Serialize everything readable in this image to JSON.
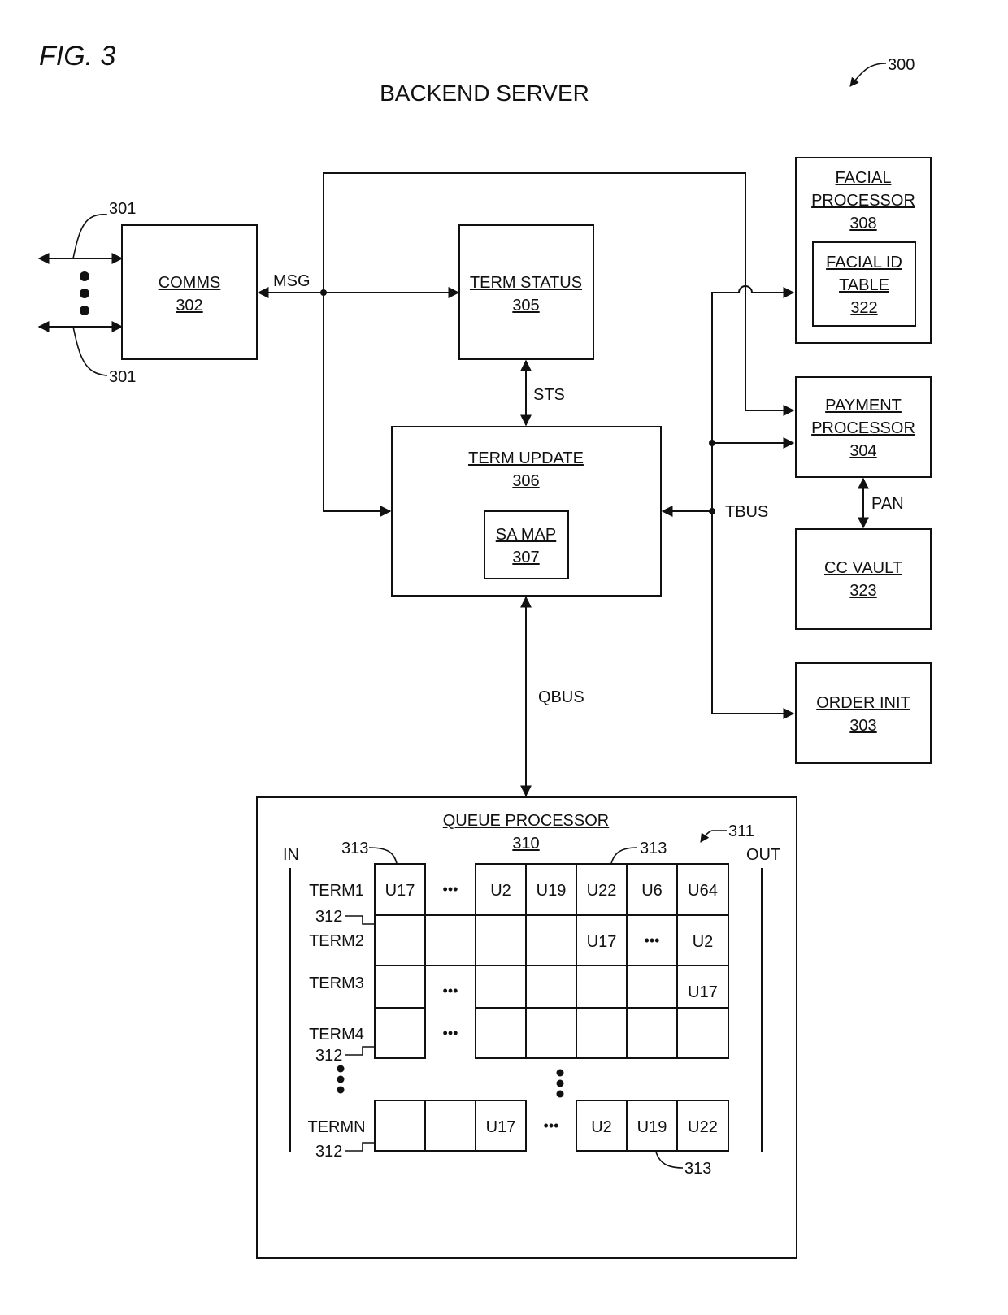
{
  "figure": {
    "label": "FIG. 3",
    "title": "BACKEND SERVER",
    "ref": "300"
  },
  "blocks": {
    "comms": {
      "name": "COMMS",
      "ref": "302"
    },
    "term_status": {
      "name": "TERM STATUS",
      "ref": "305"
    },
    "term_update": {
      "name": "TERM UPDATE",
      "ref": "306"
    },
    "sa_map": {
      "name": "SA MAP",
      "ref": "307"
    },
    "facial_processor": {
      "name_line1": "FACIAL",
      "name_line2": "PROCESSOR",
      "ref": "308"
    },
    "facial_id_table": {
      "name_line1": "FACIAL ID",
      "name_line2": "TABLE",
      "ref": "322"
    },
    "payment_processor": {
      "name_line1": "PAYMENT",
      "name_line2": "PROCESSOR",
      "ref": "304"
    },
    "cc_vault": {
      "name": "CC VAULT",
      "ref": "323"
    },
    "order_init": {
      "name": "ORDER INIT",
      "ref": "303"
    },
    "queue_processor": {
      "name": "QUEUE PROCESSOR",
      "ref": "310"
    }
  },
  "signals": {
    "msg": "MSG",
    "sts": "STS",
    "tbus": "TBUS",
    "pan": "PAN",
    "qbus": "QBUS"
  },
  "refs": {
    "ports": "301",
    "queue_matrix": "311",
    "queue_row": "312",
    "queue_entry": "313"
  },
  "queue": {
    "in_label": "IN",
    "out_label": "OUT",
    "ellipsis": "•••",
    "rows": [
      {
        "term": "TERM1",
        "cells": [
          "U17",
          "•••",
          "U2",
          "U19",
          "U22",
          "U6",
          "U64"
        ]
      },
      {
        "term": "TERM2",
        "cells": [
          "",
          "",
          "",
          "",
          "U17",
          "•••",
          "U2"
        ]
      },
      {
        "term": "TERM3",
        "cells": [
          "",
          "•••",
          "",
          "",
          "",
          "",
          "U17"
        ]
      },
      {
        "term": "TERM4",
        "cells": [
          "",
          "•••",
          "",
          "",
          "",
          "",
          ""
        ]
      },
      {
        "term": "TERMN",
        "cells": [
          "",
          "",
          "U17",
          "•••",
          "U2",
          "U19",
          "U22"
        ]
      }
    ]
  }
}
